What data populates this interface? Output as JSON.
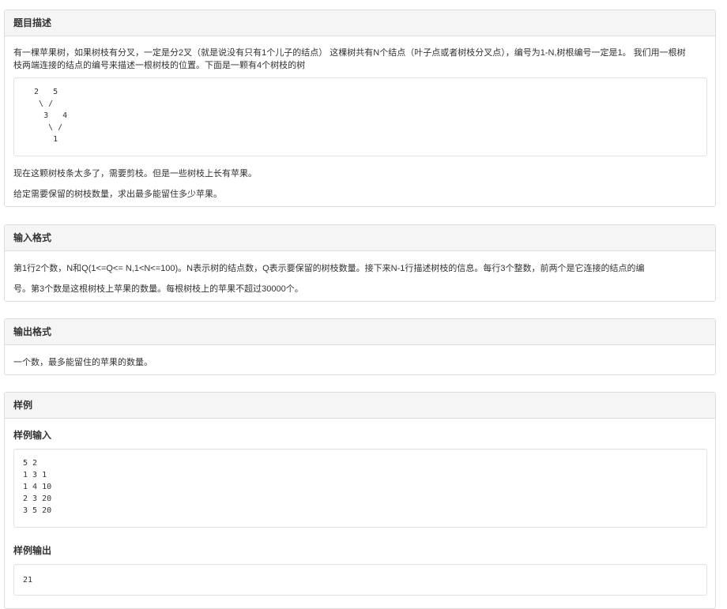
{
  "description": {
    "heading": "题目描述",
    "para1_line1": "有一棵苹果树，如果树枝有分叉，一定是分2叉（就是说没有只有1个儿子的结点） 这棵树共有N个结点（叶子点或者树枝分叉点），编号为1-N,树根编号一定是1。 我们用一根树",
    "para1_line2": "枝两端连接的结点的编号来描述一根树枝的位置。下面是一颗有4个树枝的树",
    "tree": "  2   5\n   \\ /\n    3   4\n     \\ /\n      1",
    "para2": "现在这颗树枝条太多了，需要剪枝。但是一些树枝上长有苹果。",
    "para3": "给定需要保留的树枝数量，求出最多能留住多少苹果。"
  },
  "input_format": {
    "heading": "输入格式",
    "line1": "第1行2个数，N和Q(1<=Q<= N,1<N<=100)。N表示树的结点数，Q表示要保留的树枝数量。接下来N-1行描述树枝的信息。每行3个整数，前两个是它连接的结点的编",
    "line2": "号。第3个数是这根树枝上苹果的数量。每根树枝上的苹果不超过30000个。"
  },
  "output_format": {
    "heading": "输出格式",
    "line1": "一个数，最多能留住的苹果的数量。"
  },
  "sample": {
    "heading": "样例",
    "input_label": "样例输入",
    "input_text": "5 2\n1 3 1\n1 4 10\n2 3 20\n3 5 20",
    "output_label": "样例输出",
    "output_text": "21"
  }
}
